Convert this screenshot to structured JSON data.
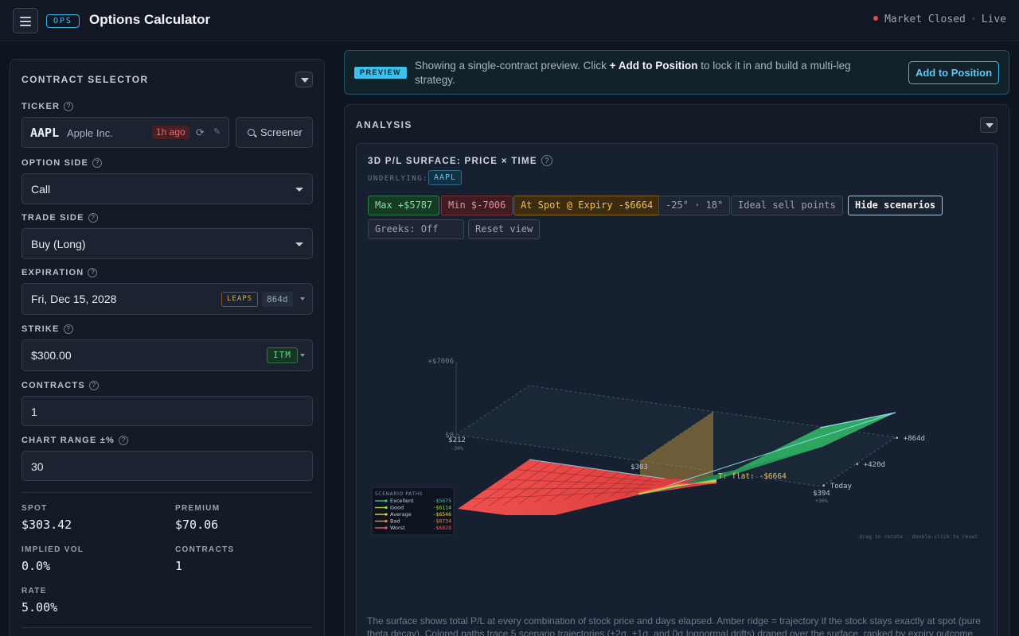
{
  "header": {
    "badge": "OPS",
    "title": "Options Calculator",
    "market_status": "Market Closed",
    "mode": "Live"
  },
  "contract_selector": {
    "title": "CONTRACT SELECTOR",
    "ticker": {
      "label": "TICKER",
      "symbol": "AAPL",
      "name": "Apple Inc.",
      "age": "1h ago",
      "screener_label": "Screener"
    },
    "option_side": {
      "label": "OPTION SIDE",
      "value": "Call"
    },
    "trade_side": {
      "label": "TRADE SIDE",
      "value": "Buy (Long)"
    },
    "expiration": {
      "label": "EXPIRATION",
      "value": "Fri, Dec 15, 2028",
      "badge": "LEAPS",
      "days": "864d"
    },
    "strike": {
      "label": "STRIKE",
      "value": "$300.00",
      "badge": "ITM"
    },
    "contracts": {
      "label": "CONTRACTS",
      "value": "1"
    },
    "chart_range": {
      "label": "CHART RANGE ±%",
      "value": "30"
    },
    "stats": {
      "spot_label": "SPOT",
      "spot": "$303.42",
      "premium_label": "PREMIUM",
      "premium": "$70.06",
      "iv_label": "IMPLIED VOL",
      "iv": "0.0%",
      "contracts_label": "CONTRACTS",
      "contracts": "1",
      "rate_label": "RATE",
      "rate": "5.00%"
    },
    "help_glyph": "?"
  },
  "preview": {
    "badge": "PREVIEW",
    "text_before": "Showing a single-contract preview. Click ",
    "text_bold": "+ Add to Position",
    "text_after": " to lock it in and build a multi-leg strategy.",
    "button": "Add to Position"
  },
  "analysis": {
    "title": "ANALYSIS",
    "chart_title": "3D P/L SURFACE: PRICE × TIME",
    "underlying_label": "UNDERLYING:",
    "underlying": "AAPL",
    "chips": {
      "max": "Max +$5787",
      "min": "Min $-7006",
      "spot_expiry": "At Spot @ Expiry -$6664",
      "angles": "-25° · 18°",
      "ideal": "Ideal sell points",
      "hide": "Hide scenarios",
      "greeks": "Greeks: Off",
      "reset": "Reset view"
    },
    "hint": "drag to rotate · double-click to reset",
    "footnote": "The surface shows total P/L at every combination of stock price and days elapsed. Amber ridge = trajectory if the stock stays exactly at spot (pure theta decay). Colored paths trace 5 scenario trajectories (±2σ, ±1σ, and 0σ lognormal drifts) draped over the surface, ranked by expiry outcome"
  },
  "chart_data": {
    "type": "3d-surface",
    "title": "3D P/L SURFACE: PRICE × TIME",
    "z_ticks": [
      "+$7006",
      "$0"
    ],
    "price_ticks": [
      {
        "label": "$212",
        "sub": "-30%"
      },
      {
        "label": "$303",
        "sub": ""
      },
      {
        "label": "$394",
        "sub": "+30%"
      }
    ],
    "time_ticks": [
      "Today",
      "+420d",
      "+864d"
    ],
    "z_range": [
      -7006,
      7006
    ],
    "max_pl": 5787,
    "min_pl": -7006,
    "spot_at_expiry_pl": -6664,
    "flat_label": "T: flat: -$6664",
    "legend_title": "SCENARIO PATHS",
    "scenarios": [
      {
        "name": "Excellent",
        "value": "-$5675",
        "color": "#3fc0a0"
      },
      {
        "name": "Good",
        "value": "-$6114",
        "color": "#9fd84a"
      },
      {
        "name": "Average",
        "value": "-$6546",
        "color": "#f2d23a"
      },
      {
        "name": "Bad",
        "value": "-$6734",
        "color": "#f08a3a"
      },
      {
        "name": "Worst",
        "value": "-$6828",
        "color": "#f05a5a"
      }
    ]
  }
}
